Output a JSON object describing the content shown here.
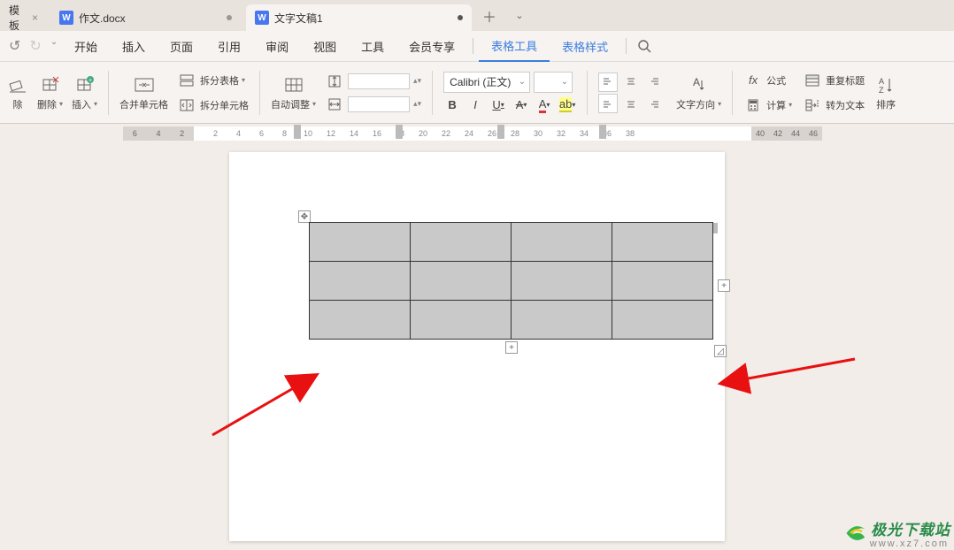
{
  "tabs": {
    "first": "模板",
    "doc1": "作文.docx",
    "doc2": "文字文稿1"
  },
  "menu": {
    "start": "开始",
    "insert": "插入",
    "page": "页面",
    "ref": "引用",
    "review": "审阅",
    "view": "视图",
    "tools": "工具",
    "member": "会员专享",
    "tableTools": "表格工具",
    "tableStyle": "表格样式"
  },
  "ribbon": {
    "clear": "除",
    "delete": "删除",
    "insert": "插入",
    "merge": "合并单元格",
    "splitTable": "拆分表格",
    "splitCell": "拆分单元格",
    "autoFit": "自动调整",
    "fontName": "Calibri (正文)",
    "textDir": "文字方向",
    "formula": "公式",
    "calc": "计算",
    "repeatHeader": "重复标题",
    "toText": "转为文本",
    "sort": "排序"
  },
  "ruler": {
    "left": [
      "6",
      "4",
      "2"
    ],
    "main": [
      "2",
      "4",
      "6",
      "8",
      "10",
      "12",
      "14",
      "16",
      "18",
      "20",
      "22",
      "24",
      "26",
      "28",
      "30",
      "32",
      "34",
      "36",
      "38"
    ],
    "right": [
      "40",
      "42",
      "44",
      "46"
    ]
  },
  "format": {
    "bold": "B",
    "italic": "I",
    "underline": "U",
    "strike": "A",
    "fontColor": "A",
    "highlight": "A"
  },
  "fx": "fx",
  "watermark": {
    "brand": "极光下载站",
    "url": "www.xz7.com"
  }
}
